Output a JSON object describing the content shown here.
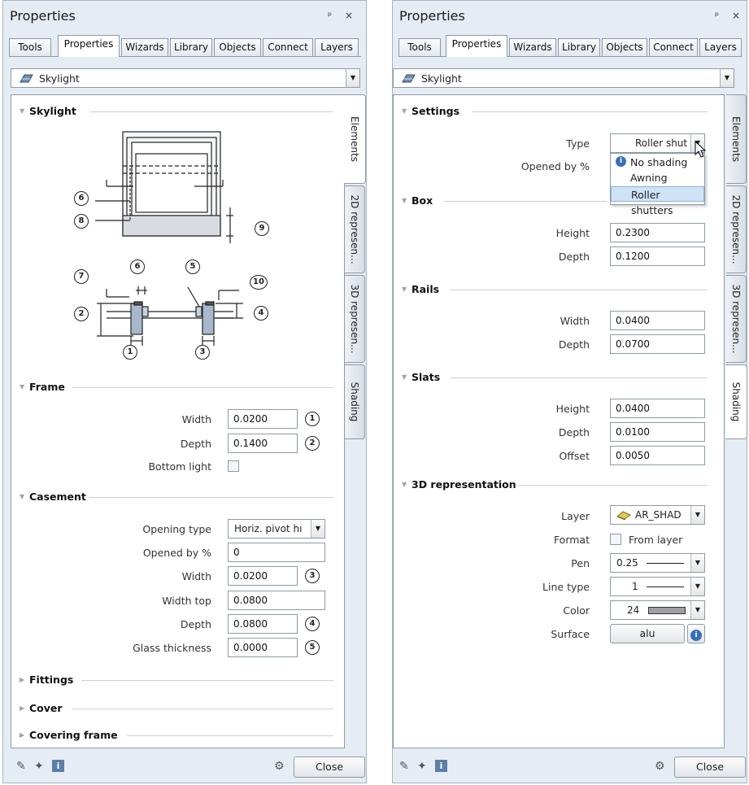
{
  "left_panel": {
    "title": "Properties",
    "pin_close": "ᵖ ×",
    "tabs": [
      "Tools",
      "Properties",
      "Wizards",
      "Library",
      "Objects",
      "Connect",
      "Layers"
    ],
    "element_combo": "Skylight",
    "side_tabs": [
      "Elements",
      "2D represen...",
      "3D represen...",
      "Shading"
    ],
    "section_skylight": "Skylight",
    "diagram_markers": [
      "1",
      "2",
      "3",
      "4",
      "5",
      "6",
      "7",
      "8",
      "9",
      "10"
    ],
    "section_frame": "Frame",
    "frame": {
      "width_label": "Width",
      "width_value": "0.0200",
      "width_marker": "1",
      "depth_label": "Depth",
      "depth_value": "0.1400",
      "depth_marker": "2",
      "bottom_light_label": "Bottom light"
    },
    "section_casement": "Casement",
    "casement": {
      "opening_type_label": "Opening type",
      "opening_type_value": "Horiz. pivot hı",
      "opened_label": "Opened by %",
      "opened_value": "0",
      "width_label": "Width",
      "width_value": "0.0200",
      "width_marker": "3",
      "width_top_label": "Width top",
      "width_top_value": "0.0800",
      "depth_label": "Depth",
      "depth_value": "0.0800",
      "depth_marker": "4",
      "glass_label": "Glass thickness",
      "glass_value": "0.0000",
      "glass_marker": "5"
    },
    "section_fittings": "Fittings",
    "section_cover": "Cover",
    "section_covering_frame": "Covering frame",
    "close_label": "Close"
  },
  "right_panel": {
    "title": "Properties",
    "pin_close": "ᵖ ×",
    "tabs": [
      "Tools",
      "Properties",
      "Wizards",
      "Library",
      "Objects",
      "Connect",
      "Layers"
    ],
    "element_combo": "Skylight",
    "side_tabs": [
      "Elements",
      "2D represen...",
      "3D represen...",
      "Shading"
    ],
    "section_settings": "Settings",
    "settings": {
      "type_label": "Type",
      "type_value": "Roller shut",
      "opened_label": "Opened by %",
      "type_options": [
        "No shading",
        "Awning",
        "Roller shutters"
      ],
      "selected_option": "Roller shutters"
    },
    "section_box": "Box",
    "box": {
      "height_label": "Height",
      "height_value": "0.2300",
      "depth_label": "Depth",
      "depth_value": "0.1200"
    },
    "section_rails": "Rails",
    "rails": {
      "width_label": "Width",
      "width_value": "0.0400",
      "depth_label": "Depth",
      "depth_value": "0.0700"
    },
    "section_slats": "Slats",
    "slats": {
      "height_label": "Height",
      "height_value": "0.0400",
      "depth_label": "Depth",
      "depth_value": "0.0100",
      "offset_label": "Offset",
      "offset_value": "0.0050"
    },
    "section_3d": "3D representation",
    "rep3d": {
      "layer_label": "Layer",
      "layer_value": "AR_SHAD",
      "format_label": "Format",
      "format_value": "From layer",
      "pen_label": "Pen",
      "pen_value": "0.25",
      "linetype_label": "Line type",
      "linetype_value": "1",
      "color_label": "Color",
      "color_value": "24",
      "surface_label": "Surface",
      "surface_value": "alu"
    },
    "close_label": "Close"
  },
  "colors": {
    "panel_bg": "#e6ecf3",
    "border": "#8e9aa8",
    "selection": "#cfe3f7",
    "color_swatch": "#a0a0a0"
  }
}
